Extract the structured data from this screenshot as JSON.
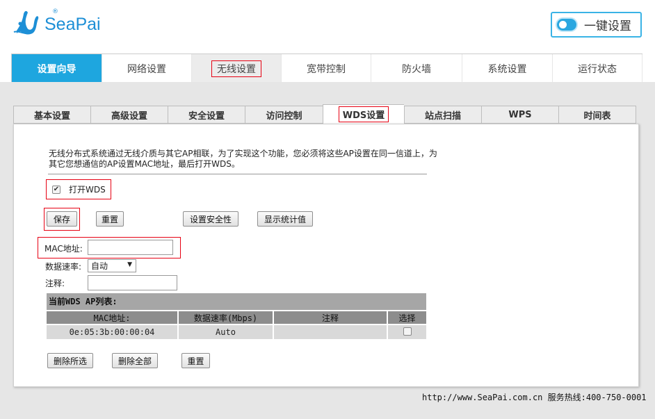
{
  "brand": {
    "name": "SeaPai",
    "reg_mark": "®"
  },
  "quick_setup": {
    "label": "一键设置"
  },
  "main_nav": [
    {
      "label": "设置向导"
    },
    {
      "label": "网络设置"
    },
    {
      "label": "无线设置"
    },
    {
      "label": "宽带控制"
    },
    {
      "label": "防火墙"
    },
    {
      "label": "系统设置"
    },
    {
      "label": "运行状态"
    }
  ],
  "sub_nav": [
    {
      "label": "基本设置"
    },
    {
      "label": "高级设置"
    },
    {
      "label": "安全设置"
    },
    {
      "label": "访问控制"
    },
    {
      "label": "WDS设置"
    },
    {
      "label": "站点扫描"
    },
    {
      "label": "WPS"
    },
    {
      "label": "时间表"
    }
  ],
  "description": "无线分布式系统通过无线介质与其它AP相联，为了实现这个功能，您必须将这些AP设置在同一信道上，为其它您想通信的AP设置MAC地址，最后打开WDS。",
  "wds_enable": {
    "label": "打开WDS",
    "checked": true,
    "check_glyph": "✔"
  },
  "buttons": {
    "save": "保存",
    "reset": "重置",
    "security": "设置安全性",
    "stats": "显示统计值"
  },
  "form": {
    "mac_label": "MAC地址:",
    "mac_value": "",
    "rate_label": "数据速率:",
    "rate_value": "自动",
    "rate_arrow": "▼",
    "comment_label": "注释:",
    "comment_value": ""
  },
  "ap_list": {
    "title": "当前WDS AP列表:",
    "columns": [
      "MAC地址:",
      "数据速率(Mbps)",
      "注释",
      "选择"
    ],
    "rows": [
      {
        "mac": "0e:05:3b:00:00:04",
        "rate": "Auto",
        "comment": "",
        "selected": false
      }
    ]
  },
  "list_buttons": {
    "delete_selected": "删除所选",
    "delete_all": "删除全部",
    "reset": "重置"
  },
  "footer": {
    "text": "http://www.SeaPai.com.cn 服务热线:400-750-0001"
  },
  "colors": {
    "accent": "#1ea6df",
    "highlight_border": "#e60012",
    "logo": "#1d8fd6"
  }
}
